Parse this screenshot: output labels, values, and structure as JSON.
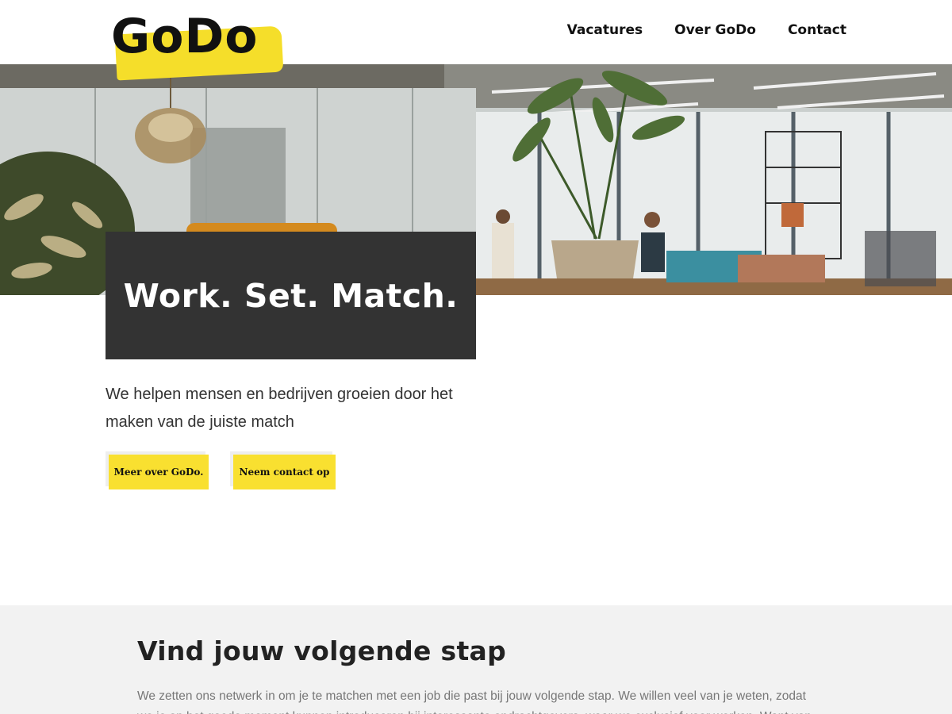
{
  "header": {
    "logo_text": "GoDo",
    "nav": [
      "Vacatures",
      "Over GoDo",
      "Contact"
    ]
  },
  "hero": {
    "title": "Work. Set. Match."
  },
  "intro": {
    "text": "We helpen mensen en bedrijven groeien door het maken van de juiste match",
    "buttons": [
      "Meer over GoDo.",
      "Neem contact op"
    ]
  },
  "section": {
    "title": "Vind jouw volgende stap",
    "text": "We zetten ons netwerk in om je te matchen met een job die past bij jouw volgende stap. We willen veel van je weten, zodat we je op het goede moment kunnen introduceren bij interessante opdrachtgevers, waar we exclusief voor werken. Want van een"
  },
  "colors": {
    "accent_yellow": "#f9e030",
    "title_box": "#333333",
    "section_bg": "#f2f2f2"
  }
}
